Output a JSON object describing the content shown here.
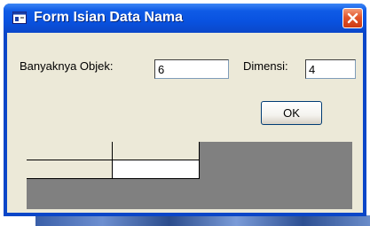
{
  "window": {
    "title": "Form Isian Data Nama"
  },
  "form": {
    "objects_label": "Banyaknya Objek:",
    "objects_value": "6",
    "dimension_label": "Dimensi:",
    "dimension_value": "4",
    "ok_label": "OK"
  },
  "grid": {
    "rows": 2,
    "cols": 2,
    "cells": [
      [
        "",
        ""
      ],
      [
        "",
        ""
      ]
    ]
  },
  "colors": {
    "titlebar": "#0a52e0",
    "client": "#ece9d8",
    "grid_background": "#808080",
    "close_button": "#e2552b"
  }
}
